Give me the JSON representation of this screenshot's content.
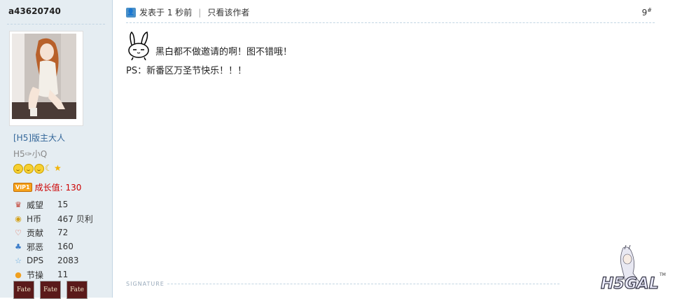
{
  "author": {
    "username": "a43620740",
    "group": "[H5]版主大人",
    "nickname": "H5✑小Q",
    "growth_label": "成长值: 130",
    "vip_badge": "VIP1",
    "stats": [
      {
        "label": "威望",
        "value": "15",
        "icon": "crown-icon"
      },
      {
        "label": "H币",
        "value": "467 贝利",
        "icon": "coin-icon"
      },
      {
        "label": "贡献",
        "value": "72",
        "icon": "heart-icon"
      },
      {
        "label": "邪恶",
        "value": "160",
        "icon": "devil-icon"
      },
      {
        "label": "DPS",
        "value": "2083",
        "icon": "star-icon"
      },
      {
        "label": "节操",
        "value": "11",
        "icon": "bulb-icon"
      }
    ],
    "medals": [
      "Fate",
      "Fate",
      "Fate"
    ]
  },
  "post": {
    "posted": "发表于 1 秒前",
    "only_author": "只看该作者",
    "floor": "9",
    "floor_mark": "#",
    "line1": "黑白都不做邀请的啊！图不错哦！",
    "line2": "PS：新番区万圣节快乐！！！",
    "signature_label": "SIGNATURE"
  },
  "logo": {
    "text": "H5GAL",
    "tm": "TM"
  }
}
